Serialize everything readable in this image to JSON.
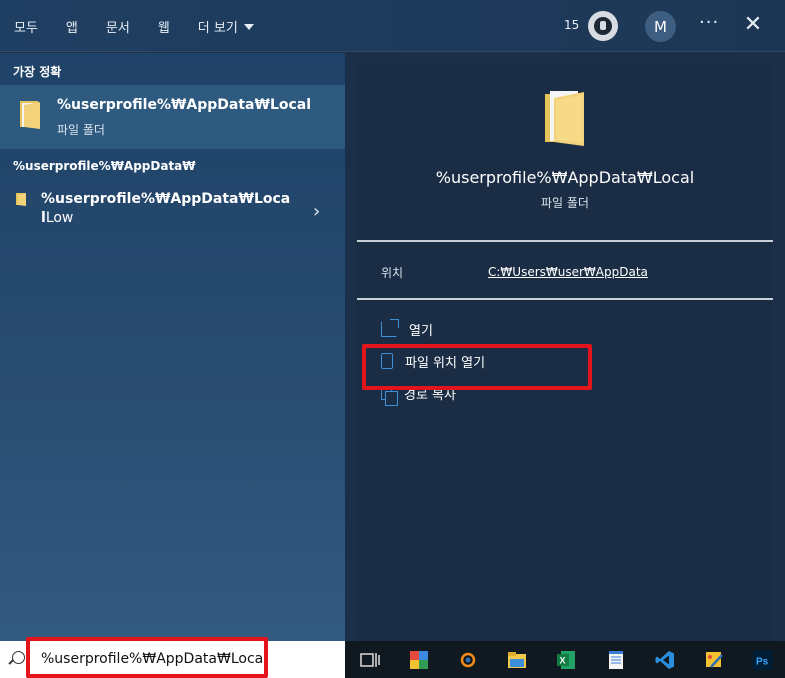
{
  "tabs": [
    {
      "label": "모두"
    },
    {
      "label": "앱"
    },
    {
      "label": "문서"
    },
    {
      "label": "웹"
    },
    {
      "label": "더 보기"
    }
  ],
  "header": {
    "rewards_count": "15",
    "avatar_initial": "M",
    "more_label": "···",
    "close_label": "✕"
  },
  "results": {
    "best_match_header": "가장 정확",
    "best_match": {
      "title": "%userprofile%₩AppData₩Local",
      "subtitle": "파일 폴더"
    },
    "group_header": "%userprofile%₩AppData₩",
    "item": {
      "title_bold": "%userprofile%₩AppData₩Local",
      "title_rest": "Low"
    }
  },
  "preview": {
    "title": "%userprofile%₩AppData₩Local",
    "subtitle": "파일 폴더",
    "location_label": "위치",
    "location_value": "C:₩Users₩user₩AppData",
    "actions": [
      {
        "label": "열기",
        "icon": "open-icon"
      },
      {
        "label": "파일 위치 열기",
        "icon": "folder-location-icon"
      },
      {
        "label": "경로 복사",
        "icon": "copy-icon"
      }
    ]
  },
  "search": {
    "value": "%userprofile%₩AppData₩Local"
  },
  "taskbar": {
    "icons": [
      "task-view-icon",
      "app-icon",
      "blender-icon",
      "file-explorer-icon",
      "excel-icon",
      "notepad-icon",
      "vscode-icon",
      "paint-icon",
      "photoshop-icon"
    ],
    "ps_label": "Ps"
  },
  "colors": {
    "highlight": "#e3141c",
    "accent": "#3f8fd6"
  }
}
